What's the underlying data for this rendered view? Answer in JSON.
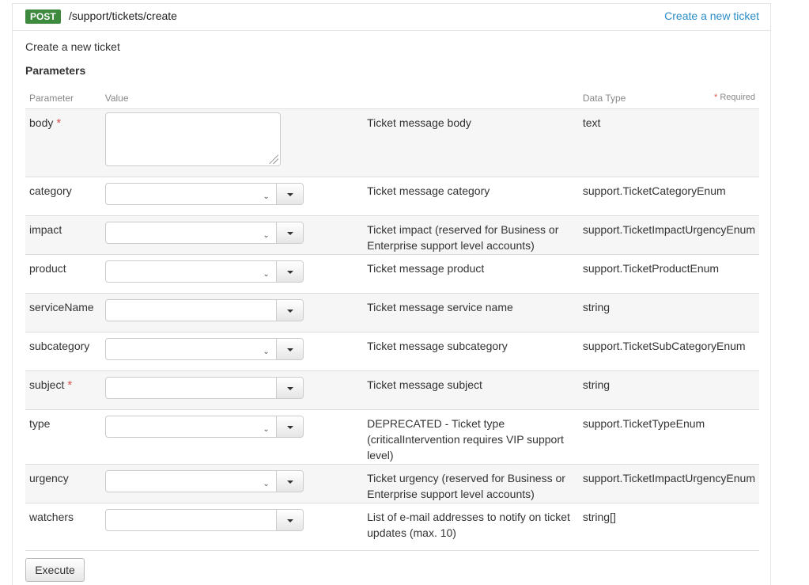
{
  "endpoint": {
    "method": "POST",
    "path": "/support/tickets/create",
    "summary_link": "Create a new ticket",
    "description": "Create a new ticket"
  },
  "parameters_heading": "Parameters",
  "table": {
    "headers": {
      "parameter": "Parameter",
      "value": "Value",
      "description": "",
      "data_type": "Data Type",
      "required_star": "*",
      "required_label": "Required"
    },
    "rows": [
      {
        "name": "body",
        "required": "*",
        "control": "textarea",
        "description": "Ticket message body",
        "type": "text"
      },
      {
        "name": "category",
        "required": "",
        "control": "select",
        "description": "Ticket message category",
        "type": "support.TicketCategoryEnum"
      },
      {
        "name": "impact",
        "required": "",
        "control": "select",
        "description": "Ticket impact (reserved for Business or Enterprise support level accounts)",
        "type": "support.TicketImpactUrgencyEnum"
      },
      {
        "name": "product",
        "required": "",
        "control": "select",
        "description": "Ticket message product",
        "type": "support.TicketProductEnum"
      },
      {
        "name": "serviceName",
        "required": "",
        "control": "combo",
        "description": "Ticket message service name",
        "type": "string"
      },
      {
        "name": "subcategory",
        "required": "",
        "control": "select",
        "description": "Ticket message subcategory",
        "type": "support.TicketSubCategoryEnum"
      },
      {
        "name": "subject",
        "required": "*",
        "control": "combo",
        "description": "Ticket message subject",
        "type": "string"
      },
      {
        "name": "type",
        "required": "",
        "control": "select",
        "description": "DEPRECATED - Ticket type (criticalIntervention requires VIP support level)",
        "type": "support.TicketTypeEnum"
      },
      {
        "name": "urgency",
        "required": "",
        "control": "select",
        "description": "Ticket urgency (reserved for Business or Enterprise support level accounts)",
        "type": "support.TicketImpactUrgencyEnum"
      },
      {
        "name": "watchers",
        "required": "",
        "control": "combo",
        "description": "List of e-mail addresses to notify on ticket updates (max. 10)",
        "type": "string[]"
      }
    ]
  },
  "execute_label": "Execute",
  "colors": {
    "method_badge": "#3d8a3f",
    "link": "#2a8cc8",
    "required_star": "#d9534f"
  }
}
